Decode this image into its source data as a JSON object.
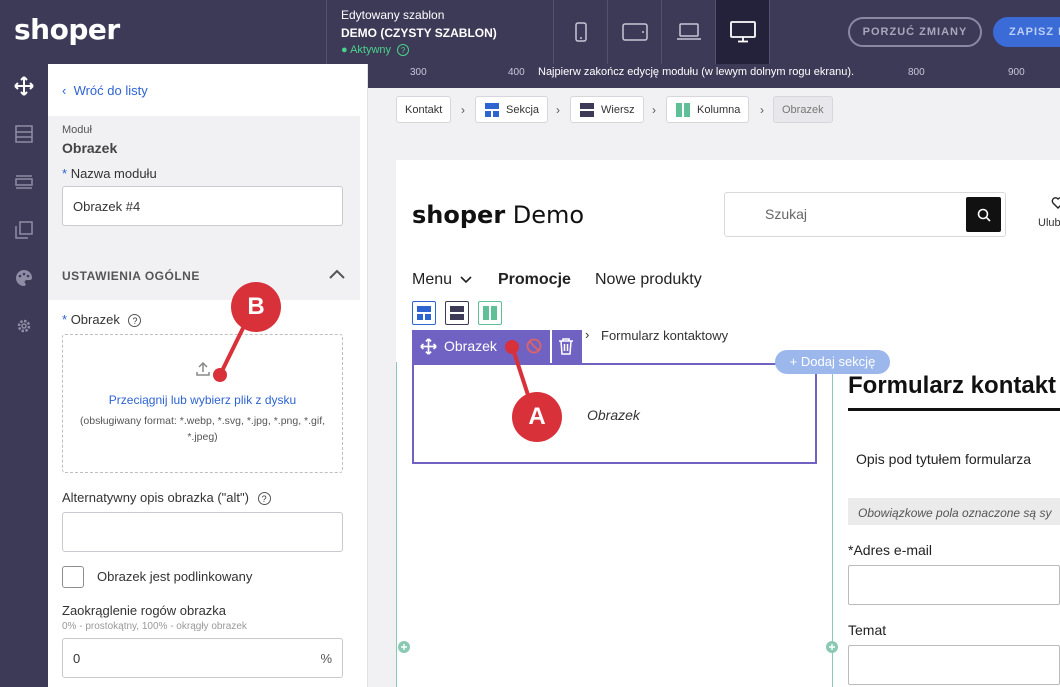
{
  "topbar": {
    "logo": "shoper",
    "template_label": "Edytowany szablon",
    "template_name": "DEMO (CZYSTY SZABLON)",
    "status": "Aktywny",
    "discard_label": "PORZUĆ ZMIANY",
    "save_label": "ZAPISZ I"
  },
  "rail": {
    "icons": [
      "move-icon",
      "layout-icon",
      "rows-icon",
      "pages-icon",
      "palette-icon",
      "settings-icon"
    ]
  },
  "panel": {
    "back_label": "Wróć do listy",
    "module_label": "Moduł",
    "module_title": "Obrazek",
    "name_label": "Nazwa modułu",
    "name_value": "Obrazek #4",
    "section_title": "USTAWIENIA OGÓLNE",
    "image_label": "Obrazek",
    "drop_text": "Przeciągnij lub wybierz plik z dysku",
    "drop_formats": "(obsługiwany format: *.webp, *.svg, *.jpg, *.png, *.gif, *.jpeg)",
    "alt_label": "Alternatywny opis obrazka (\"alt\")",
    "alt_value": "",
    "linked_label": "Obrazek jest podlinkowany",
    "radius_label": "Zaokrąglenie rogów obrazka",
    "radius_hint": "0% - prostokątny, 100% - okrągły obrazek",
    "radius_value": "0",
    "radius_unit": "%"
  },
  "ruler": {
    "ticks": [
      "300",
      "400",
      "800",
      "900"
    ],
    "message": "Najpierw zakończ edycję modułu (w lewym dolnym rogu ekranu)."
  },
  "breadcrumb": [
    "Kontakt",
    "Sekcja",
    "Wiersz",
    "Kolumna",
    "Obrazek"
  ],
  "preview": {
    "logo_bold": "shoper",
    "logo_rest": " Demo",
    "search_placeholder": "Szukaj",
    "fav_label": "Ulub",
    "nav": [
      "Menu",
      "Promocje",
      "Nowe produkty"
    ],
    "crumb_end": "Formularz kontaktowy",
    "module_toolbar_label": "Obrazek",
    "image_placeholder": "Obrazek",
    "add_section": "+ Dodaj sekcję",
    "form_title": "Formularz kontakt",
    "form_desc": "Opis pod tytułem formularza",
    "required_note": "Obowiązkowe pola oznaczone są sy",
    "email_label": "*Adres e-mail",
    "subject_label": "Temat"
  },
  "annotations": {
    "marker_a": "A",
    "marker_b": "B"
  },
  "colors": {
    "dark": "#3d3a57",
    "accent": "#2e64d1",
    "module": "#6f62c2",
    "marker": "#d9313a",
    "green": "#4ad18b"
  }
}
